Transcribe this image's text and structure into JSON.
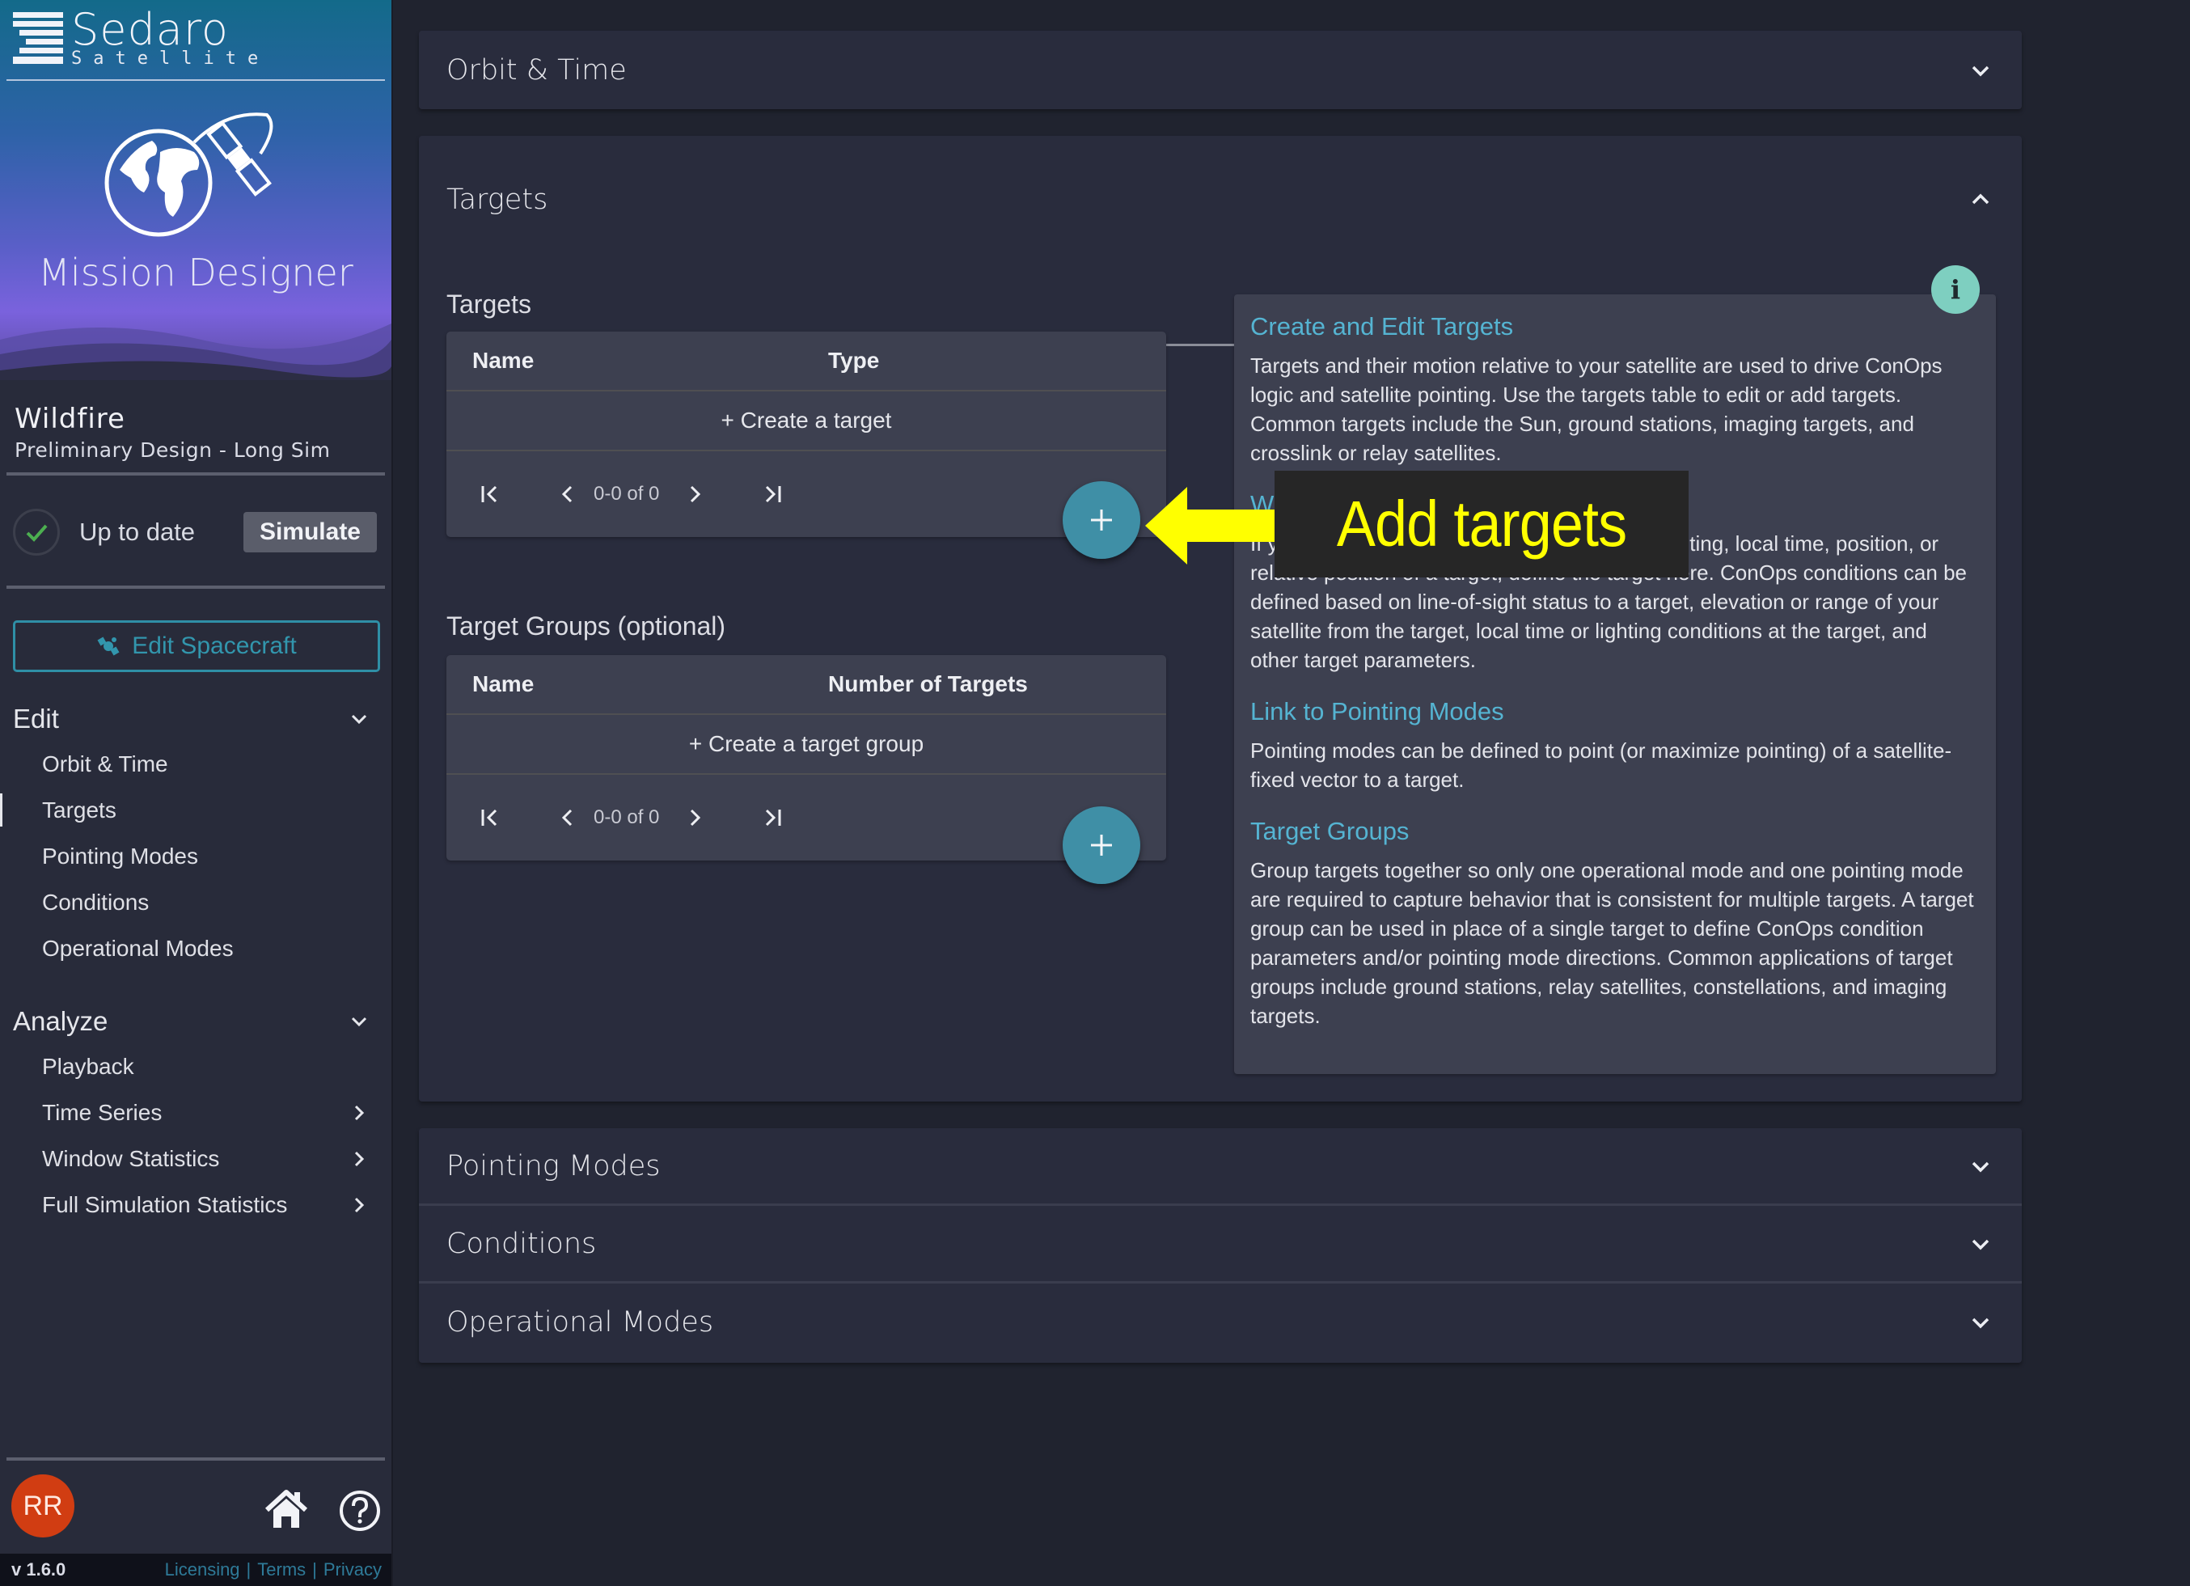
{
  "brand": {
    "logo_name": "Sedaro",
    "logo_sub": "Satellite",
    "app_title": "Mission Designer"
  },
  "project": {
    "name": "Wildfire",
    "branch": "Preliminary Design - Long Sim"
  },
  "status": {
    "icon": "check-icon",
    "text": "Up to date",
    "simulate_label": "Simulate"
  },
  "edit_spacecraft_label": "Edit Spacecraft",
  "nav": {
    "edit": {
      "label": "Edit",
      "items": [
        {
          "label": "Orbit & Time"
        },
        {
          "label": "Targets",
          "active": true
        },
        {
          "label": "Pointing Modes"
        },
        {
          "label": "Conditions"
        },
        {
          "label": "Operational Modes"
        }
      ]
    },
    "analyze": {
      "label": "Analyze",
      "items": [
        {
          "label": "Playback"
        },
        {
          "label": "Time Series",
          "has_submenu": true
        },
        {
          "label": "Window Statistics",
          "has_submenu": true
        },
        {
          "label": "Full Simulation Statistics",
          "has_submenu": true
        }
      ]
    }
  },
  "footer": {
    "avatar_initials": "RR",
    "version": "v 1.6.0",
    "links": [
      "Licensing",
      "Terms",
      "Privacy"
    ],
    "separator": "|"
  },
  "colors": {
    "accent": "#3f8fa6",
    "avatar": "#d13d12",
    "info_heading": "#55b4d2",
    "info_badge": "#7ecfc0",
    "callout": "#ffff00"
  },
  "sections": {
    "orbit_time": {
      "title": "Orbit & Time",
      "expanded": false
    },
    "targets": {
      "title": "Targets",
      "expanded": true,
      "targets_table": {
        "label": "Targets",
        "columns": [
          "Name",
          "Type"
        ],
        "empty_action": "+ Create a target",
        "pagination": "0-0 of 0",
        "add_button_icon": "plus-icon"
      },
      "groups_table": {
        "label": "Target Groups (optional)",
        "columns": [
          "Name",
          "Number of Targets"
        ],
        "empty_action": "+ Create a target group",
        "pagination": "0-0 of 0",
        "add_button_icon": "plus-icon"
      },
      "info": {
        "badge": "i",
        "blocks": [
          {
            "heading": "Create and Edit Targets",
            "body": "Targets and their motion relative to your satellite are used to drive ConOps logic and satellite pointing. Use the targets table to edit or add targets. Common targets include the Sun, ground stations, imaging targets, and crosslink or relay satellites."
          },
          {
            "heading": "W",
            "body": "If y                                                      by the lighting, local time, position, or relative position of a target, define the target here. ConOps conditions can be defined based on line-of-sight status to a target, elevation or range of your satellite from the target, local time or lighting conditions at the target, and other target parameters."
          },
          {
            "heading": "Link to Pointing Modes",
            "body": "Pointing modes can be defined to point (or maximize pointing) of a satellite-fixed vector to a target."
          },
          {
            "heading": "Target Groups",
            "body": "Group targets together so only one operational mode and one pointing mode are required to capture behavior that is consistent for multiple targets. A target group can be used in place of a single target to define ConOps condition parameters and/or pointing mode directions. Common applications of target groups include ground stations, relay satellites, constellations, and imaging targets."
          }
        ]
      }
    },
    "pointing_modes": {
      "title": "Pointing Modes",
      "expanded": false
    },
    "conditions": {
      "title": "Conditions",
      "expanded": false
    },
    "operational_modes": {
      "title": "Operational Modes",
      "expanded": false
    }
  },
  "annotation": {
    "text": "Add targets",
    "icon": "arrow-left-icon"
  }
}
